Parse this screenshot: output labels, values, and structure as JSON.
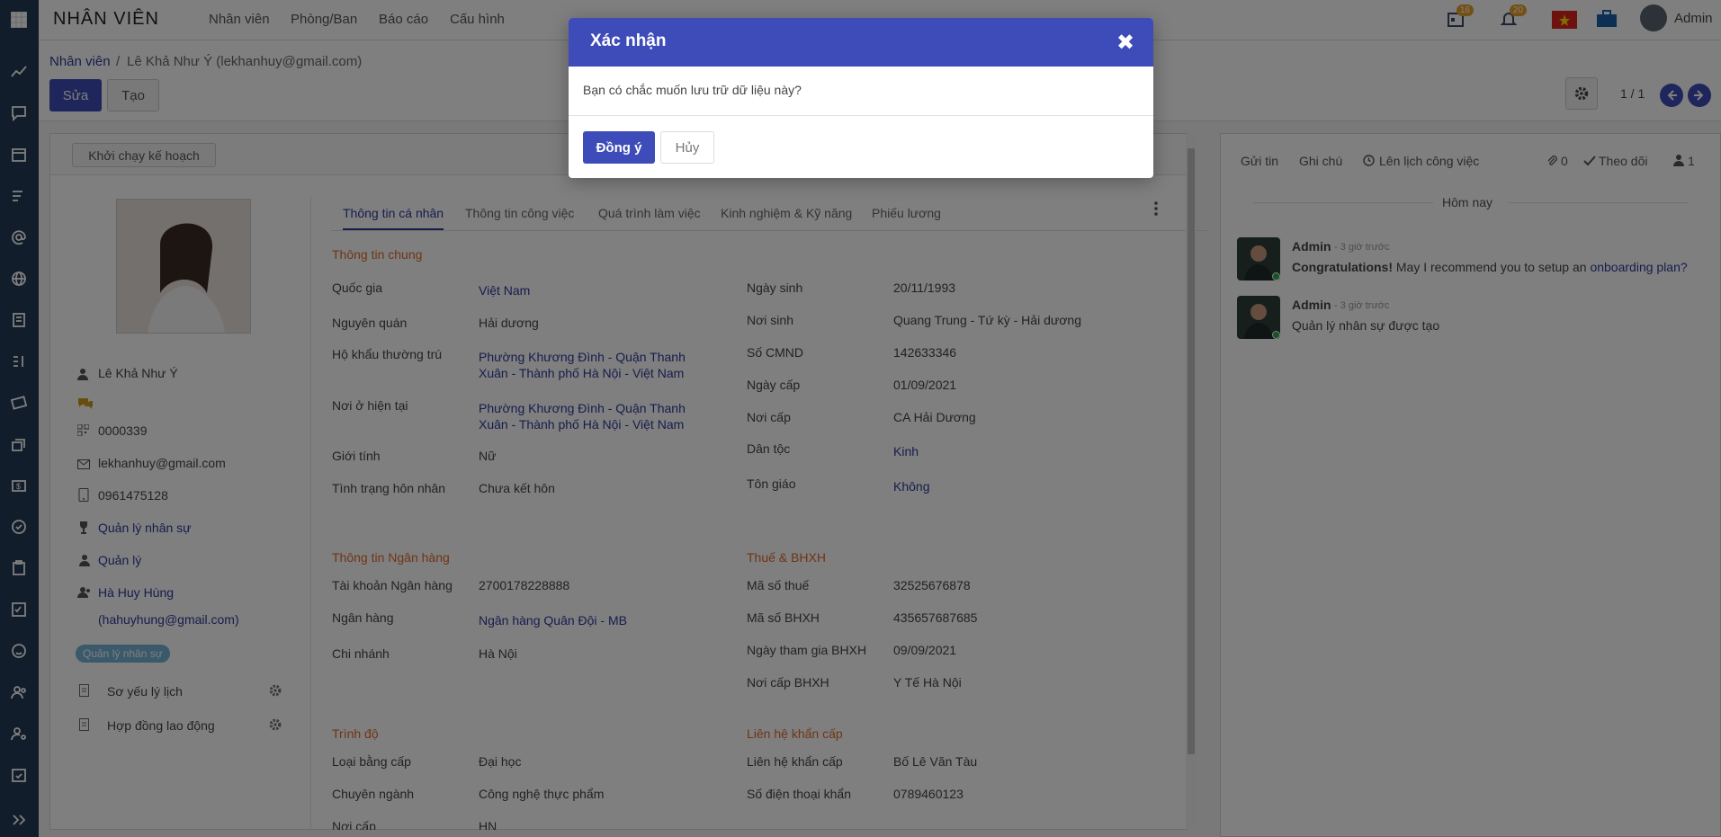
{
  "app": {
    "title": "NHÂN VIÊN",
    "menu": [
      "Nhân viên",
      "Phòng/Ban",
      "Báo cáo",
      "Cấu hình"
    ]
  },
  "topbar": {
    "calendar_count": "16",
    "bell_count": "20",
    "user": "Admin"
  },
  "breadcrumb": {
    "parent": "Nhân viên",
    "sep": "/",
    "current": "Lê Khả Như Ý (lekhanhuy@gmail.com)"
  },
  "toolbar": {
    "edit": "Sửa",
    "create": "Tạo",
    "pager": "1 / 1"
  },
  "sheet": {
    "run_plan": "Khởi chạy kế hoạch"
  },
  "profile": {
    "name": "Lê Khả Như Ý",
    "code": "0000339",
    "email": "lekhanhuy@gmail.com",
    "phone": "0961475128",
    "department": "Quản lý nhân sự",
    "job": "Quản lý",
    "manager": "Hà Huy Hùng",
    "manager_email": "(hahuyhung@gmail.com)",
    "tag": "Quản lý nhân sự",
    "docs": [
      "Sơ yếu lý lịch",
      "Hợp đồng lao động"
    ]
  },
  "tabs": [
    "Thông tin cá nhân",
    "Thông tin công việc",
    "Quá trình làm việc",
    "Kinh nghiệm & Kỹ năng",
    "Phiếu lương"
  ],
  "general": {
    "title": "Thông tin chung",
    "country_l": "Quốc gia",
    "country": "Việt Nam",
    "origin_l": "Nguyên quán",
    "origin": "Hải dương",
    "perm_l": "Hộ khẩu thường trú",
    "perm1": "Phường Khương Đình - Quận Thanh",
    "perm2": "Xuân - Thành phố Hà Nội - Việt Nam",
    "cur_l": "Nơi ở hiện tại",
    "cur1": "Phường Khương Đình - Quận Thanh",
    "cur2": "Xuân - Thành phố Hà Nội - Việt Nam",
    "gender_l": "Giới tính",
    "gender": "Nữ",
    "marital_l": "Tình trạng hôn nhân",
    "marital": "Chưa kết hôn",
    "dob_l": "Ngày sinh",
    "dob": "20/11/1993",
    "pob_l": "Nơi sinh",
    "pob": "Quang Trung - Tứ kỳ - Hải dương",
    "id_l": "Số CMND",
    "id": "142633346",
    "iss_date_l": "Ngày cấp",
    "iss_date": "01/09/2021",
    "iss_place_l": "Nơi cấp",
    "iss_place": "CA Hải Dương",
    "ethnic_l": "Dân tộc",
    "ethnic": "Kinh",
    "religion_l": "Tôn giáo",
    "religion": "Không"
  },
  "bank": {
    "title": "Thông tin Ngân hàng",
    "acc_l": "Tài khoản Ngân hàng",
    "acc": "2700178228888",
    "bank_l": "Ngân hàng",
    "bank": "Ngân hàng Quân Đội - MB",
    "branch_l": "Chi nhánh",
    "branch": "Hà Nội"
  },
  "tax": {
    "title": "Thuế & BHXH",
    "tax_l": "Mã số thuế",
    "tax": "32525676878",
    "si_l": "Mã số BHXH",
    "si": "435657687685",
    "si_date_l": "Ngày tham gia BHXH",
    "si_date": "09/09/2021",
    "si_place_l": "Nơi cấp BHXH",
    "si_place": "Y Tế Hà Nội"
  },
  "edu": {
    "title": "Trình độ",
    "degree_l": "Loại bằng cấp",
    "degree": "Đại học",
    "major_l": "Chuyên ngành",
    "major": "Công nghệ thực phẩm",
    "place_l": "Nơi cấp",
    "place": "HN"
  },
  "emergency": {
    "title": "Liên hệ khẩn cấp",
    "contact_l": "Liên hệ khẩn cấp",
    "contact": "Bố Lê Văn Tàu",
    "phone_l": "Số điện thoại khẩn",
    "phone": "0789460123"
  },
  "chatter": {
    "send": "Gửi tin",
    "note": "Ghi chú",
    "schedule": "Lên lịch công việc",
    "attach": "0",
    "follow": "Theo dõi",
    "followers": "1",
    "today": "Hôm nay",
    "messages": [
      {
        "author": "Admin",
        "time": "- 3 giờ trước",
        "bold": "Congratulations!",
        "text": " May I recommend you to setup an ",
        "link": "onboarding plan?"
      },
      {
        "author": "Admin",
        "time": "- 3 giờ trước",
        "text": "Quản lý nhân sự được tạo"
      }
    ]
  },
  "dialog": {
    "title": "Xác nhận",
    "close": "✖",
    "message": "Bạn có chắc muốn lưu trữ dữ liệu này?",
    "ok": "Đồng ý",
    "cancel": "Hủy"
  },
  "colors": {
    "primary": "#3e4cb9",
    "sidebar": "#253a57",
    "section": "#e06a2b",
    "link": "#2d3a9b"
  }
}
